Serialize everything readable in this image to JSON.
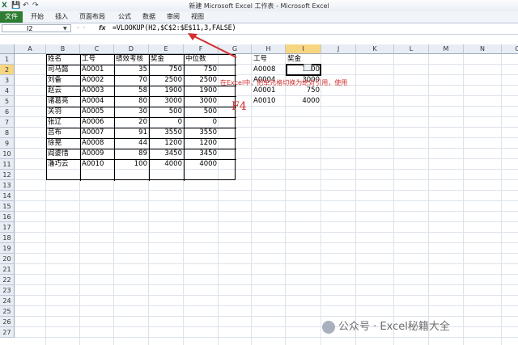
{
  "window_title": "新建 Microsoft Excel 工作表 - Microsoft Excel",
  "quick_access": {
    "save": "💾",
    "undo": "↶",
    "redo": "↷"
  },
  "ribbon": {
    "file_tab": "文件",
    "tabs": [
      "开始",
      "插入",
      "页面布局",
      "公式",
      "数据",
      "审阅",
      "视图"
    ]
  },
  "formula_bar": {
    "name_box": "I2",
    "fx": "fx",
    "formula": "=VLOOKUP(H2,$C$2:$E$11,3,FALSE)"
  },
  "columns": [
    "A",
    "B",
    "C",
    "D",
    "E",
    "F",
    "G",
    "H",
    "I",
    "J",
    "K",
    "L",
    "M",
    "N",
    "O"
  ],
  "rows": [
    "1",
    "2",
    "3",
    "4",
    "5",
    "6",
    "7",
    "8",
    "9",
    "10",
    "11",
    "12",
    "13",
    "14",
    "15",
    "16",
    "17",
    "18",
    "19",
    "20",
    "21",
    "22",
    "23",
    "24",
    "25",
    "26",
    "27"
  ],
  "selected_column": "I",
  "selected_row": "2",
  "main_table": {
    "headers": [
      "姓名",
      "工号",
      "绩效考核",
      "奖金",
      "中位数"
    ],
    "rows": [
      [
        "司马懿",
        "A0001",
        "35",
        "750",
        "750"
      ],
      [
        "刘备",
        "A0002",
        "70",
        "2500",
        "2500"
      ],
      [
        "赵云",
        "A0003",
        "58",
        "1900",
        "1900"
      ],
      [
        "诸葛亮",
        "A0004",
        "80",
        "3000",
        "3000"
      ],
      [
        "关羽",
        "A0005",
        "30",
        "500",
        "500"
      ],
      [
        "张辽",
        "A0006",
        "20",
        "0",
        "0"
      ],
      [
        "吕布",
        "A0007",
        "91",
        "3550",
        "3550"
      ],
      [
        "徐晃",
        "A0008",
        "44",
        "1200",
        "1200"
      ],
      [
        "阎婆惜",
        "A0009",
        "89",
        "3450",
        "3450"
      ],
      [
        "潘巧云",
        "A0010",
        "100",
        "4000",
        "4000"
      ]
    ]
  },
  "lookup_table": {
    "headers": [
      "工号",
      "奖金"
    ],
    "rows": [
      [
        "A0008",
        "1200"
      ],
      [
        "A0004",
        "3000"
      ],
      [
        "A0001",
        "750"
      ],
      [
        "A0010",
        "4000"
      ]
    ]
  },
  "annotation_text": "在Excel中，把单元格切换为绝对引用，使用",
  "annotation_key": "F4",
  "watermark": "公众号 · Excel秘籍大全",
  "colors": {
    "file_tab": "#2e7d32",
    "annotation": "#d32f2f",
    "selected_header": "#f7d681"
  }
}
